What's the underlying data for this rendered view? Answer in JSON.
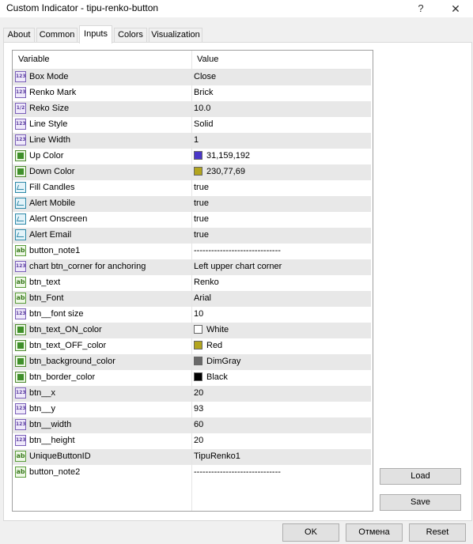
{
  "window": {
    "title": "Custom Indicator - tipu-renko-button",
    "help_glyph": "?",
    "close_glyph": "✕"
  },
  "tabs": [
    {
      "label": "About"
    },
    {
      "label": "Common"
    },
    {
      "label": "Inputs"
    },
    {
      "label": "Colors"
    },
    {
      "label": "Visualization"
    }
  ],
  "active_tab": "Inputs",
  "grid": {
    "col_variable": "Variable",
    "col_value": "Value",
    "rows": [
      {
        "type": "int",
        "icon_text": "123",
        "variable": "Box Mode",
        "value": "Close"
      },
      {
        "type": "int",
        "icon_text": "123",
        "variable": "Renko Mark",
        "value": "Brick"
      },
      {
        "type": "double",
        "icon_text": "1/2",
        "variable": "Reko Size",
        "value": "10.0"
      },
      {
        "type": "int",
        "icon_text": "123",
        "variable": "Line Style",
        "value": "Solid"
      },
      {
        "type": "int",
        "icon_text": "123",
        "variable": "Line Width",
        "value": "1"
      },
      {
        "type": "color",
        "icon_text": "",
        "variable": "Up Color",
        "value": "31,159,192",
        "swatch": "#4a37c8"
      },
      {
        "type": "color",
        "icon_text": "",
        "variable": "Down Color",
        "value": "230,77,69",
        "swatch": "#b3a51e"
      },
      {
        "type": "bool",
        "icon_text": "",
        "variable": "Fill Candles",
        "value": "true"
      },
      {
        "type": "bool",
        "icon_text": "",
        "variable": "Alert Mobile",
        "value": "true"
      },
      {
        "type": "bool",
        "icon_text": "",
        "variable": "Alert Onscreen",
        "value": "true"
      },
      {
        "type": "bool",
        "icon_text": "",
        "variable": "Alert Email",
        "value": "true"
      },
      {
        "type": "string",
        "icon_text": "ab",
        "variable": "button_note1",
        "value": "------------------------------"
      },
      {
        "type": "int",
        "icon_text": "123",
        "variable": "chart btn_corner for anchoring",
        "value": "Left upper chart corner"
      },
      {
        "type": "string",
        "icon_text": "ab",
        "variable": "btn_text",
        "value": "Renko"
      },
      {
        "type": "string",
        "icon_text": "ab",
        "variable": "btn_Font",
        "value": "Arial"
      },
      {
        "type": "int",
        "icon_text": "123",
        "variable": "btn__font size",
        "value": "10"
      },
      {
        "type": "color",
        "icon_text": "",
        "variable": "btn_text_ON_color",
        "value": "White",
        "swatch": "#ffffff"
      },
      {
        "type": "color",
        "icon_text": "",
        "variable": "btn_text_OFF_color",
        "value": "Red",
        "swatch": "#b3a51e"
      },
      {
        "type": "color",
        "icon_text": "",
        "variable": "btn_background_color",
        "value": "DimGray",
        "swatch": "#696969"
      },
      {
        "type": "color",
        "icon_text": "",
        "variable": "btn_border_color",
        "value": "Black",
        "swatch": "#000000"
      },
      {
        "type": "int",
        "icon_text": "123",
        "variable": "btn__x",
        "value": "20"
      },
      {
        "type": "int",
        "icon_text": "123",
        "variable": "btn__y",
        "value": "93"
      },
      {
        "type": "int",
        "icon_text": "123",
        "variable": "btn__width",
        "value": "60"
      },
      {
        "type": "int",
        "icon_text": "123",
        "variable": "btn__height",
        "value": "20"
      },
      {
        "type": "string",
        "icon_text": "ab",
        "variable": "UniqueButtonID",
        "value": "TipuRenko1"
      },
      {
        "type": "string",
        "icon_text": "ab",
        "variable": "button_note2",
        "value": "------------------------------"
      }
    ]
  },
  "side_buttons": {
    "load": "Load",
    "save": "Save"
  },
  "bottom_buttons": {
    "ok": "OK",
    "cancel": "Отмена",
    "reset": "Reset"
  }
}
